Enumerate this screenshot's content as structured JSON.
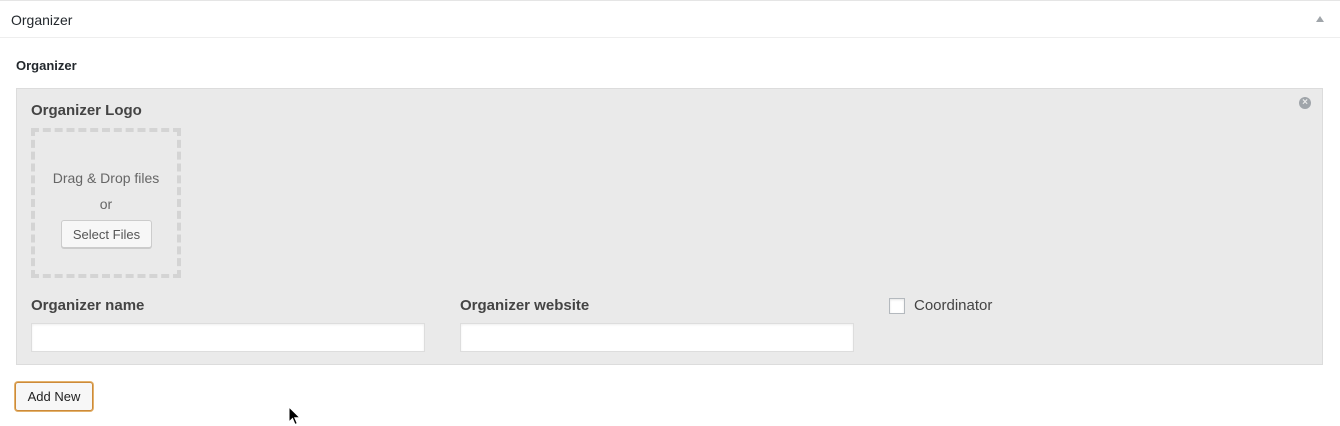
{
  "metabox": {
    "title": "Organizer",
    "toggle_icon": "triangle-up-icon"
  },
  "field": {
    "label": "Organizer"
  },
  "group": {
    "remove_icon": "close-circle-icon",
    "remove_glyph": "×",
    "logo_label": "Organizer Logo",
    "dropzone": {
      "text": "Drag & Drop files",
      "or": "or",
      "button": "Select Files"
    },
    "name_label": "Organizer name",
    "name_value": "",
    "website_label": "Organizer website",
    "website_value": "",
    "coordinator_label": "Coordinator",
    "coordinator_checked": false
  },
  "add_new": "Add New",
  "colors": {
    "group_bg": "#eaeaea",
    "add_new_border": "#cc8a3a"
  }
}
